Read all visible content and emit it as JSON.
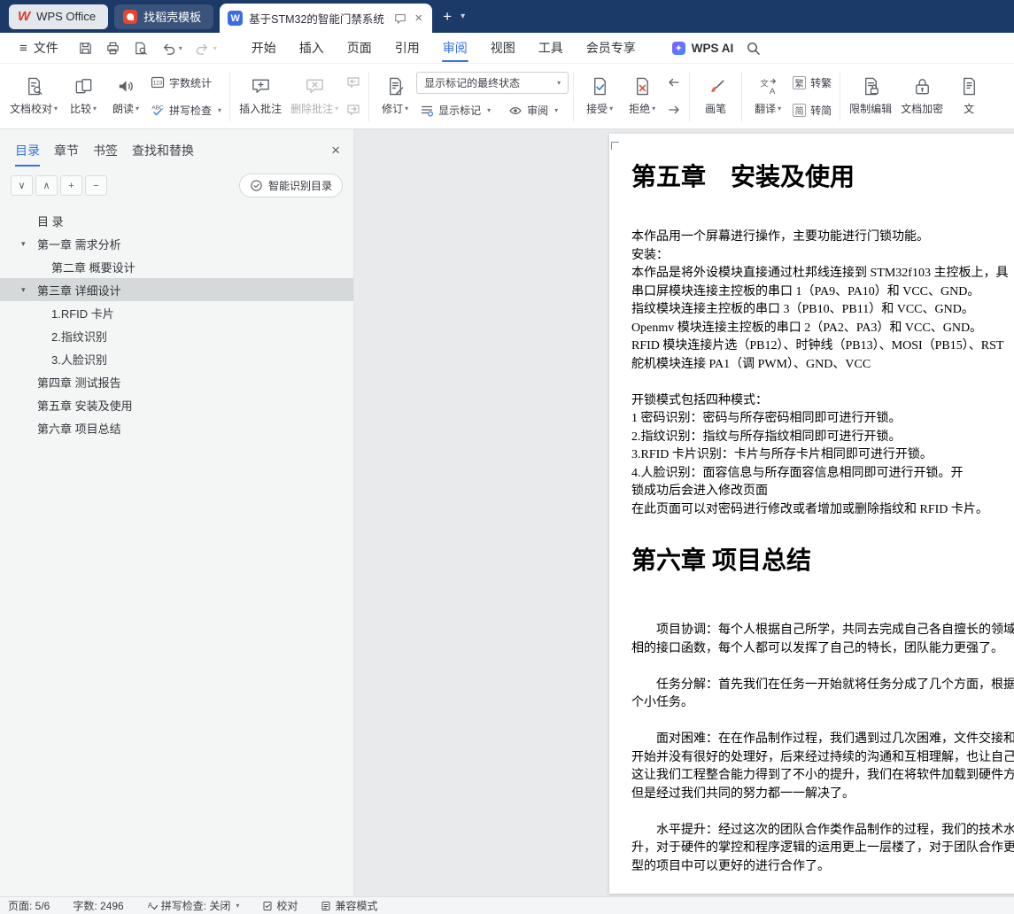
{
  "colors": {
    "titlebar_bg": "#1c3a68",
    "accent_blue": "#3571e3",
    "reject_red": "#e0473c",
    "active_tab_bg": "#ffffff",
    "sidebar_bg": "#f3f6f5",
    "canvas_bg": "#e8eaec",
    "selected_item_bg": "#d5d9d9"
  },
  "icons": {
    "chevron": "▾",
    "close": "×",
    "plus": "+",
    "hamburger": "≡",
    "wps_logo": "W",
    "word_logo": "W",
    "collapse_all": "∨",
    "expand_all": "∧",
    "add": "+",
    "remove": "−",
    "tree_expanded": "▾",
    "trad_char": "繁",
    "simp_char": "简"
  },
  "titlebar": {
    "tab_wps": "WPS Office",
    "tab_docer": "找稻壳模板",
    "tab_doc": "基于STM32的智能门禁系统 讠"
  },
  "menubar": {
    "file": "文件",
    "items": [
      "开始",
      "插入",
      "页面",
      "引用",
      "审阅",
      "视图",
      "工具",
      "会员专享"
    ],
    "active_item": "审阅",
    "wps_ai": "WPS AI"
  },
  "ribbon": {
    "doc_proof": "文档校对",
    "compare": "比较",
    "read_aloud": "朗读",
    "word_count": "字数统计",
    "spell_check": "拼写检查",
    "insert_comment": "插入批注",
    "delete_comment": "删除批注",
    "track_changes": "修订",
    "markup_state": "显示标记的最终状态",
    "show_markup": "显示标记",
    "review": "审阅",
    "accept": "接受",
    "reject": "拒绝",
    "ink_brush": "画笔",
    "translate": "翻译",
    "to_traditional": "转繁",
    "to_simplified": "转简",
    "restrict_edit": "限制编辑",
    "encrypt": "文档加密",
    "clipped": "文"
  },
  "sidebar": {
    "tabs": [
      "目录",
      "章节",
      "书签",
      "查找和替换"
    ],
    "active_tab": "目录",
    "smart_button": "智能识别目录",
    "tree": [
      {
        "label": "目 录",
        "level": 0,
        "arrow": false,
        "selected": false
      },
      {
        "label": "第一章 需求分析",
        "level": 0,
        "arrow": true,
        "selected": false
      },
      {
        "label": "第二章 概要设计",
        "level": 1,
        "arrow": false,
        "selected": false
      },
      {
        "label": "第三章 详细设计",
        "level": 0,
        "arrow": true,
        "selected": true
      },
      {
        "label": "1.RFID 卡片",
        "level": 1,
        "arrow": false,
        "selected": false
      },
      {
        "label": "2.指纹识别",
        "level": 1,
        "arrow": false,
        "selected": false
      },
      {
        "label": "3.人脸识别",
        "level": 1,
        "arrow": false,
        "selected": false
      },
      {
        "label": "第四章 测试报告",
        "level": 0,
        "arrow": false,
        "selected": false
      },
      {
        "label": "第五章 安装及使用",
        "level": 0,
        "arrow": false,
        "selected": false
      },
      {
        "label": "第六章 项目总结",
        "level": 0,
        "arrow": false,
        "selected": false
      }
    ]
  },
  "document": {
    "heading1": "第五章　安装及使用",
    "body1": [
      "本作品用一个屏幕进行操作，主要功能进行门锁功能。",
      "安装：",
      "本作品是将外设模块直接通过杜邦线连接到 STM32f103 主控板上，具",
      "串口屏模块连接主控板的串口 1（PA9、PA10）和 VCC、GND。",
      "指纹模块连接主控板的串口 3（PB10、PB11）和 VCC、GND。",
      "Openmv 模块连接主控板的串口 2（PA2、PA3）和 VCC、GND。",
      "RFID 模块连接片选（PB12）、时钟线（PB13）、MOSI（PB15）、RST",
      "舵机模块连接 PA1（调 PWM）、GND、VCC",
      "",
      "开锁模式包括四种模式：",
      "1 密码识别：密码与所存密码相同即可进行开锁。",
      "2.指纹识别：指纹与所存指纹相同即可进行开锁。",
      "3.RFID 卡片识别：卡片与所存卡片相同即可进行开锁。",
      "4.人脸识别：面容信息与所存面容信息相同即可进行开锁。开",
      "锁成功后会进入修改页面",
      "在此页面可以对密码进行修改或者增加或删除指纹和 RFID 卡片。"
    ],
    "heading2": "第六章 项目总结",
    "body2": [
      "　　项目协调：每个人根据自己所学，共同去完成自己各自擅长的领域，及",
      "相的接口函数，每个人都可以发挥了自己的特长，团队能力更强了。",
      "",
      "　　任务分解：首先我们在任务一开始就将任务分成了几个方面，根据每人",
      "个小任务。",
      "",
      "　　面对困难：在在作品制作过程，我们遇到过几次困难，文件交接和使",
      "开始并没有很好的处理好，后来经过持续的沟通和互相理解，也让自己的程序",
      "这让我们工程整合能力得到了不小的提升，我们在将软件加载到硬件方面时也",
      "但是经过我们共同的努力都一一解决了。",
      "",
      "　　水平提升：经过这次的团队合作类作品制作的过程，我们的技术水平都",
      "升，对于硬件的掌控和程序逻辑的运用更上一层楼了，对于团队合作更加熟",
      "型的项目中可以更好的进行合作了。"
    ]
  },
  "statusbar": {
    "page": "页面: 5/6",
    "words": "字数: 2496",
    "spell": "拼写检查: 关闭",
    "proof": "校对",
    "compat": "兼容模式"
  }
}
